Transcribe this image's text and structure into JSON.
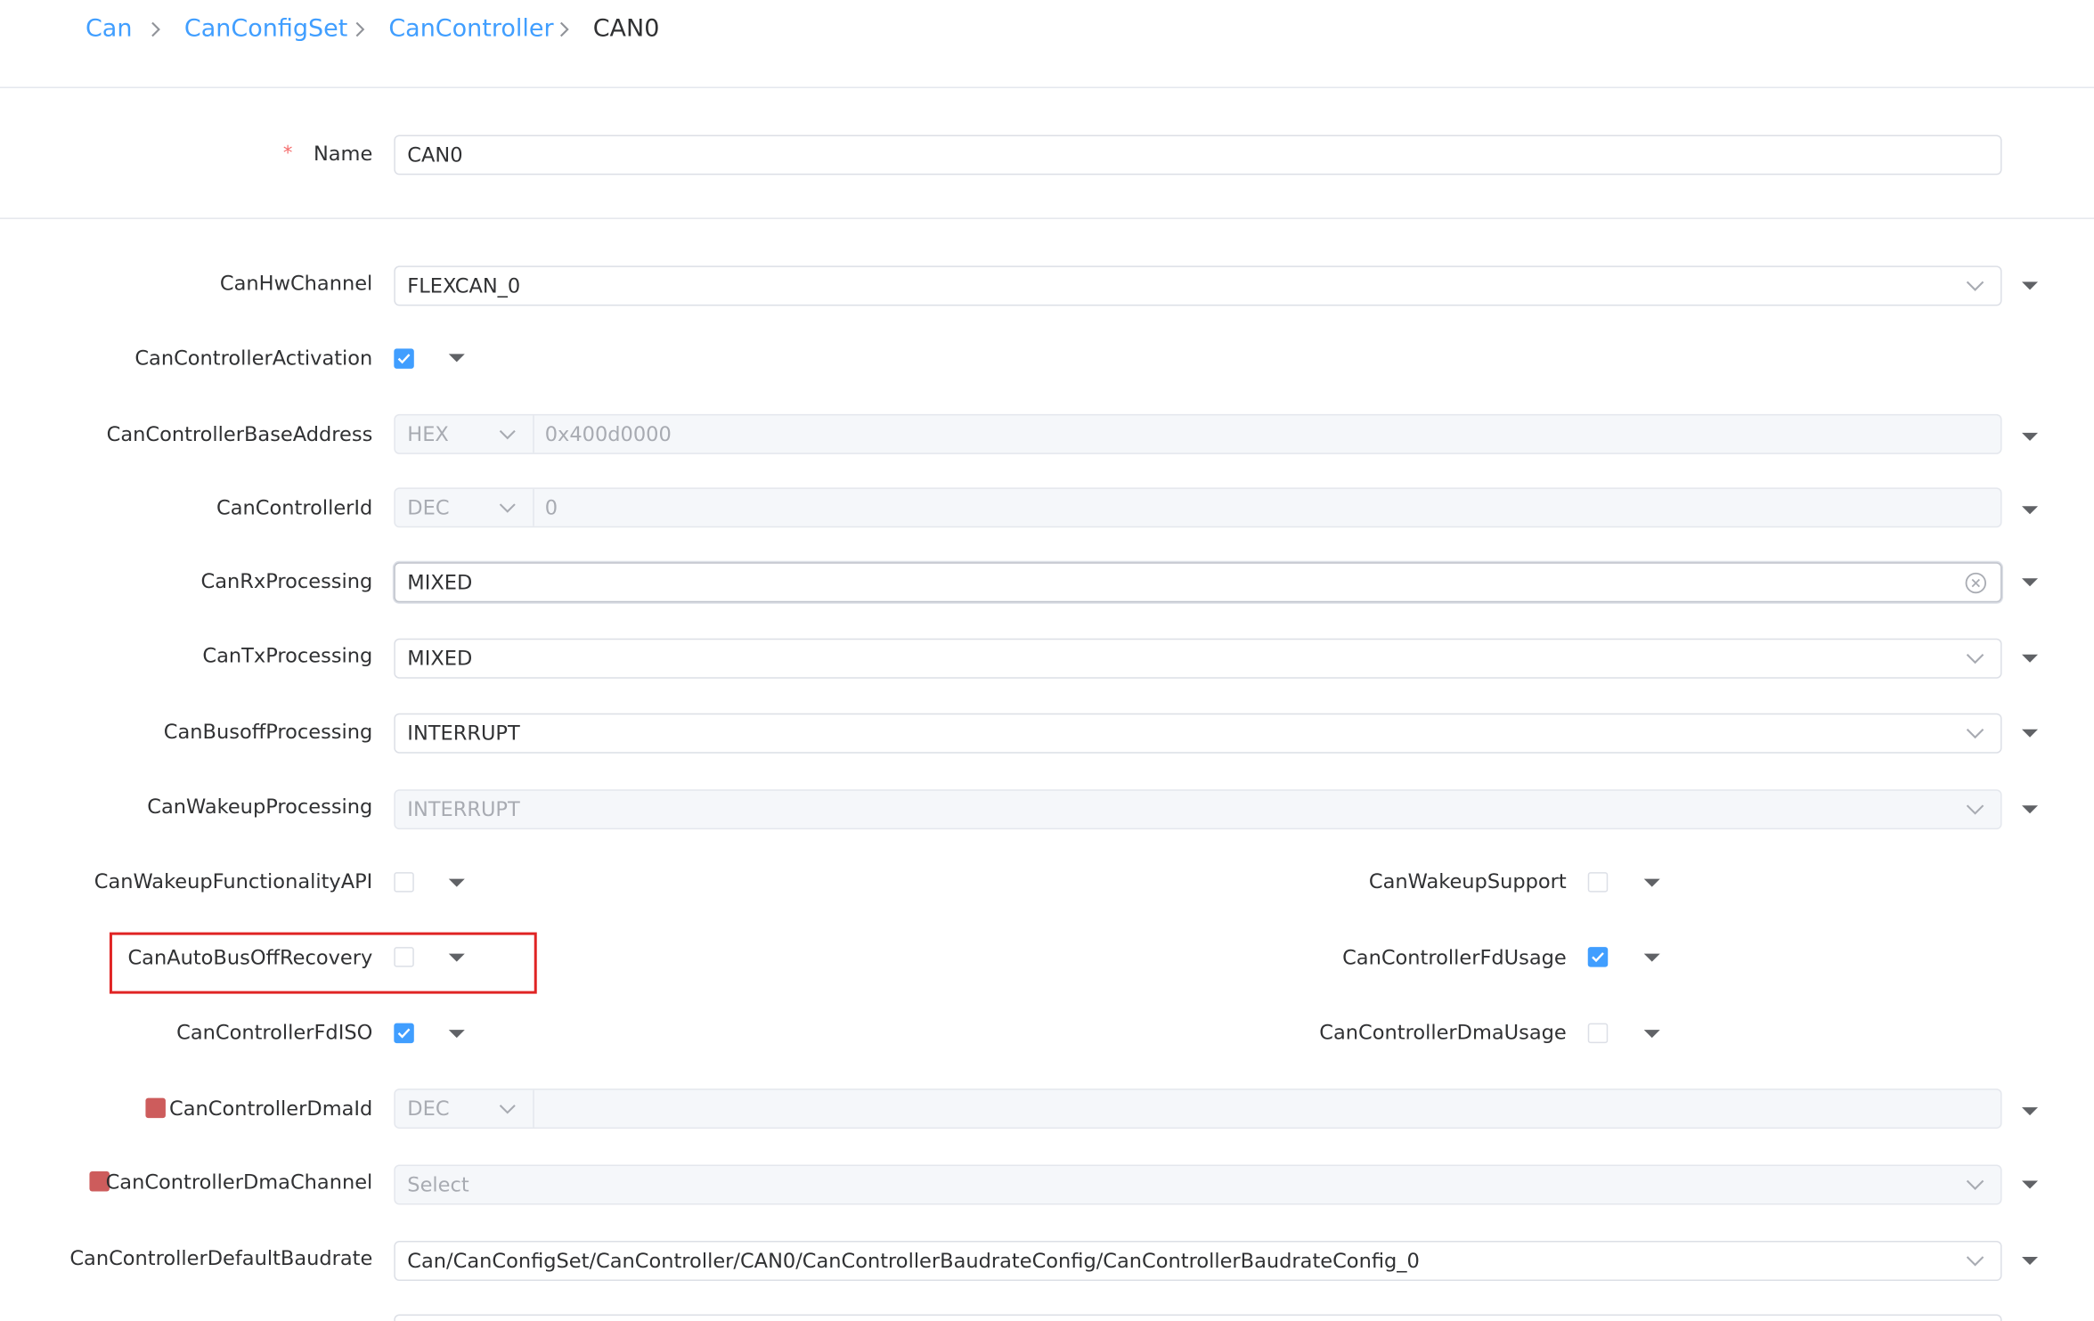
{
  "breadcrumb": {
    "items": [
      "Can",
      "CanConfigSet",
      "CanController"
    ],
    "current": "CAN0"
  },
  "name_field": {
    "label": "Name",
    "required_mark": "*",
    "value": "CAN0"
  },
  "fields": {
    "hw_channel": {
      "label": "CanHwChannel",
      "value": "FLEXCAN_0"
    },
    "controller_activation": {
      "label": "CanControllerActivation",
      "checked": true
    },
    "base_address": {
      "label": "CanControllerBaseAddress",
      "format": "HEX",
      "value": "0x400d0000"
    },
    "controller_id": {
      "label": "CanControllerId",
      "format": "DEC",
      "value": "0"
    },
    "rx_processing": {
      "label": "CanRxProcessing",
      "value": "MIXED"
    },
    "tx_processing": {
      "label": "CanTxProcessing",
      "value": "MIXED"
    },
    "busoff_processing": {
      "label": "CanBusoffProcessing",
      "value": "INTERRUPT"
    },
    "wakeup_processing": {
      "label": "CanWakeupProcessing",
      "value": "INTERRUPT"
    },
    "wakeup_functionality_api": {
      "label": "CanWakeupFunctionalityAPI",
      "checked": false
    },
    "wakeup_support": {
      "label": "CanWakeupSupport",
      "checked": false
    },
    "auto_bus_off_recovery": {
      "label": "CanAutoBusOffRecovery",
      "checked": false
    },
    "fd_usage": {
      "label": "CanControllerFdUsage",
      "checked": true
    },
    "fd_iso": {
      "label": "CanControllerFdISO",
      "checked": true
    },
    "dma_usage": {
      "label": "CanControllerDmaUsage",
      "checked": false
    },
    "dma_id": {
      "label": "CanControllerDmaId",
      "format": "DEC",
      "value": ""
    },
    "dma_channel": {
      "label": "CanControllerDmaChannel",
      "placeholder": "Select"
    },
    "default_baudrate": {
      "label": "CanControllerDefaultBaudrate",
      "value": "Can/CanConfigSet/CanController/CAN0/CanControllerBaudrateConfig/CanControllerBaudrateConfig_0"
    }
  },
  "colors": {
    "link": "#409eff",
    "checkbox_checked": "#409eff",
    "warning_marker": "#cd5c5c",
    "highlight_border": "#e02424"
  },
  "icons": {
    "breadcrumb_separator": "chevron-right-icon",
    "select_arrow": "chevron-down-icon",
    "clear": "circle-close-icon",
    "row_menu": "caret-down-icon",
    "check": "check-icon"
  }
}
